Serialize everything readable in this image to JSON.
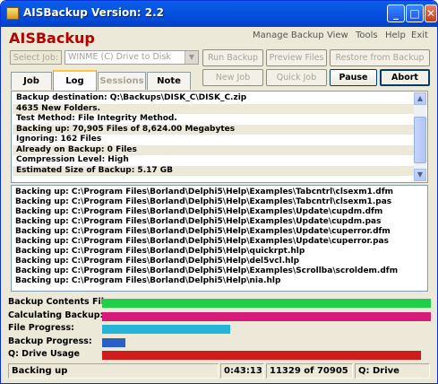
{
  "window": {
    "title": "AISBackup Version: 2.2"
  },
  "brand": "AISBackup",
  "menu": [
    "Manage Backup",
    "View",
    "Tools",
    "Help",
    "Exit"
  ],
  "toolbar": {
    "select_job_label": "Select Job:",
    "job_value": "WINME (C) Drive to Disk",
    "run_backup": "Run Backup",
    "preview_files": "Preview Files",
    "restore_from_backup": "Restore from Backup",
    "new_job": "New Job",
    "quick_job": "Quick Job",
    "pause": "Pause",
    "abort": "Abort"
  },
  "tabs": [
    {
      "label": "Job",
      "state": "normal"
    },
    {
      "label": "Log",
      "state": "selected"
    },
    {
      "label": "Sessions",
      "state": "disabled"
    },
    {
      "label": "Note",
      "state": "normal"
    }
  ],
  "info": [
    "Backup destination: Q:\\Backups\\DISK_C\\DISK_C.zip",
    "4635 New Folders.",
    "Test Method: File Integrity Method.",
    "Backing up: 70,905 Files of 8,624.00 Megabytes",
    "Ignoring: 162 Files",
    "Already on Backup: 0 Files",
    "Compression Level: High",
    "Estimated Size of Backup: 5.17 GB"
  ],
  "log": [
    "Backing up: C:\\Program Files\\Borland\\Delphi5\\Help\\Examples\\Tabcntrl\\clsexm1.dfm",
    "Backing up: C:\\Program Files\\Borland\\Delphi5\\Help\\Examples\\Tabcntrl\\clsexm1.pas",
    "Backing up: C:\\Program Files\\Borland\\Delphi5\\Help\\Examples\\Update\\cupdm.dfm",
    "Backing up: C:\\Program Files\\Borland\\Delphi5\\Help\\Examples\\Update\\cupdm.pas",
    "Backing up: C:\\Program Files\\Borland\\Delphi5\\Help\\Examples\\Update\\cuperror.dfm",
    "Backing up: C:\\Program Files\\Borland\\Delphi5\\Help\\Examples\\Update\\cuperror.pas",
    "Backing up: C:\\Program Files\\Borland\\Delphi5\\Help\\quickrpt.hlp",
    "Backing up: C:\\Program Files\\Borland\\Delphi5\\Help\\del5vcl.hlp",
    "Backing up: C:\\Program Files\\Borland\\Delphi5\\Help\\Examples\\Scrollba\\scroldem.dfm",
    "Backing up: C:\\Program Files\\Borland\\Delphi5\\Help\\nia.hlp"
  ],
  "progress": [
    {
      "label": "Backup Contents File:",
      "fraction": 1.0,
      "color": "#1fcf4a"
    },
    {
      "label": "Calculating Backup:",
      "fraction": 1.0,
      "color": "#d81b7a"
    },
    {
      "label": "File Progress:",
      "fraction": 0.39,
      "color": "#23b4d8"
    },
    {
      "label": "Backup Progress:",
      "fraction": 0.07,
      "color": "#2b5fc8"
    },
    {
      "label": "Q: Drive Usage",
      "fraction": 0.97,
      "color": "#d11c1c"
    }
  ],
  "status": {
    "state": "Backing up",
    "elapsed": "0:43:13",
    "count": "11329 of 70905",
    "drive": "Q: Drive"
  }
}
